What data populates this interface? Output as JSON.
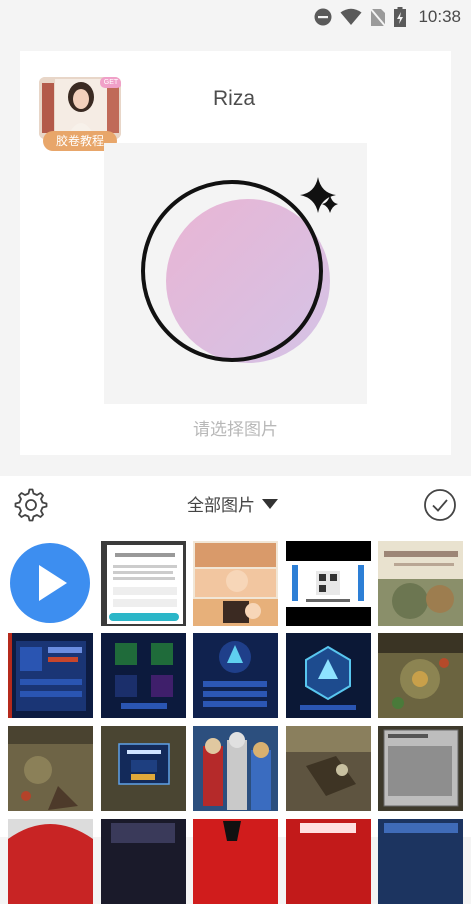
{
  "status_bar": {
    "time": "10:38",
    "icons": [
      "do-not-disturb-icon",
      "wifi-icon",
      "no-sim-icon",
      "battery-charging-icon"
    ]
  },
  "tutorial": {
    "label": "胶卷教程",
    "tag": "GET"
  },
  "user": {
    "name": "Riza"
  },
  "preview": {
    "hint": "请选择图片",
    "accent_gradient": [
      "#e6b3d6",
      "#d7c2e6"
    ]
  },
  "toolbar": {
    "album_label": "全部图片",
    "settings_icon": "gear-icon",
    "confirm_icon": "check-circle-icon"
  },
  "gallery": {
    "play_icon": "play-icon",
    "thumbnails": [
      "dialog-screenshot",
      "anime-collage",
      "web-page-screenshot",
      "painting-with-calligraphy",
      "game-hero-list",
      "game-upgrade-screen",
      "game-hero-detail",
      "game-hex-emblem",
      "game-battle-map",
      "game-rocky-battlefield",
      "game-reward-dialog",
      "superhero-poster",
      "game-cave-scene",
      "game-chat-panel",
      "red-helmet",
      "game-scene-dark",
      "red-logo-banner",
      "red-text-banner",
      "game-ui-blue"
    ]
  }
}
